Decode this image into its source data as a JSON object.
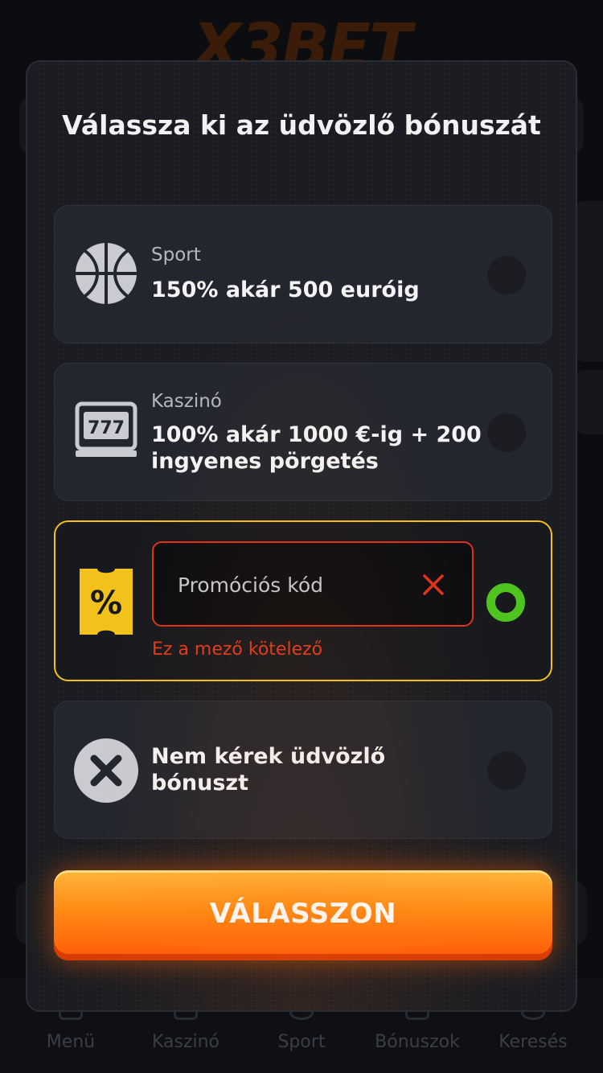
{
  "background": {
    "logo": "X3BET",
    "bottom_nav": [
      "Menü",
      "Kaszinó",
      "Sport",
      "Bónuszok",
      "Keresés"
    ]
  },
  "modal": {
    "title": "Válassza ki az üdvözlő bónuszát",
    "options": [
      {
        "category": "Sport",
        "text": "150% akár 500 euróig",
        "icon": "basketball-icon",
        "selected": false
      },
      {
        "category": "Kaszinó",
        "text": "100% akár 1000 €-ig + 200 ingyenes pörgetés",
        "icon": "slot-machine-icon",
        "selected": false
      },
      {
        "category": "",
        "text": "",
        "icon": "promo-ticket-icon",
        "selected": true
      },
      {
        "category": "",
        "text": "Nem kérek üdvözlő bónuszt",
        "icon": "no-bonus-x-icon",
        "selected": false
      }
    ],
    "promo": {
      "placeholder": "Promóciós kód",
      "value": "",
      "error": "Ez a mező kötelező"
    },
    "submit_label": "VÁLASSZON"
  },
  "colors": {
    "accent_orange": "#ff7a12",
    "selected_border": "#f2c21b",
    "radio_on": "#4fc41e",
    "error": "#e03218"
  }
}
